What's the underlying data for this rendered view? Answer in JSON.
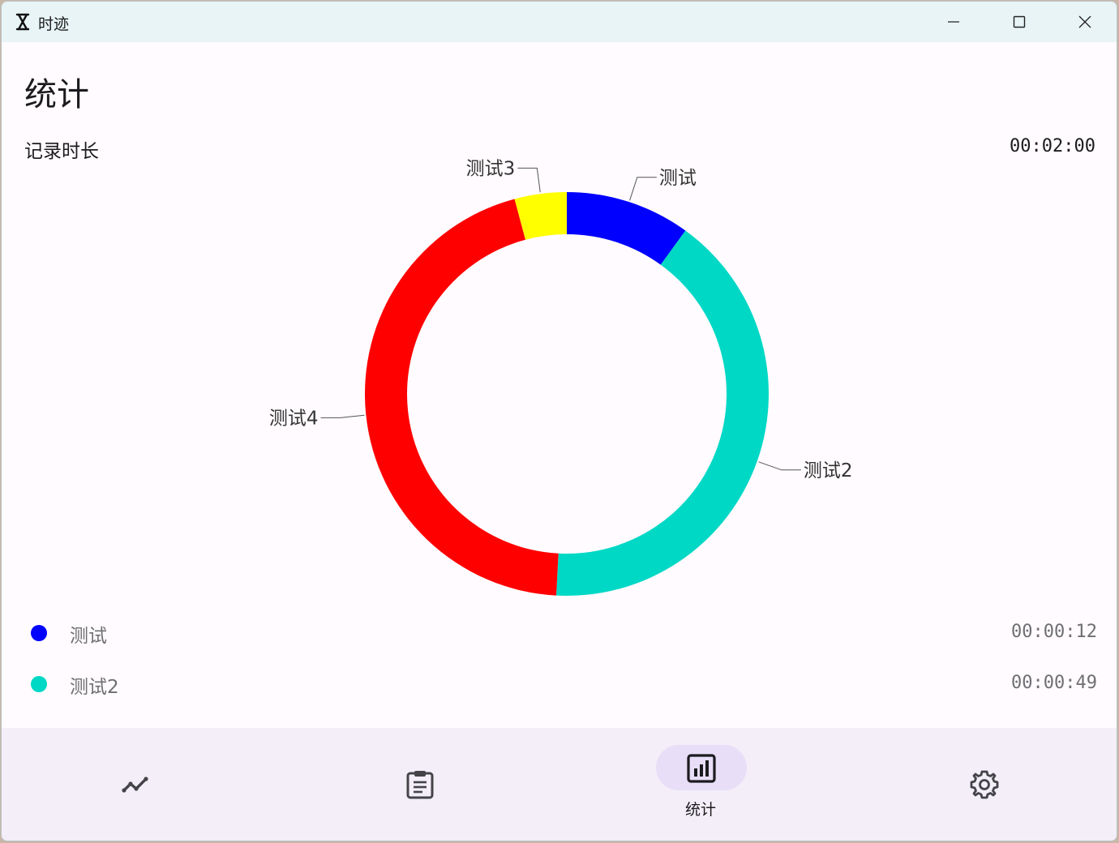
{
  "window": {
    "title": "时迹"
  },
  "page": {
    "title": "统计",
    "total_label": "记录时长",
    "total_value": "00:02:00"
  },
  "chart_data": {
    "type": "pie",
    "style": "donut",
    "categories": [
      "测试",
      "测试2",
      "测试4",
      "测试3"
    ],
    "values": [
      12,
      49,
      54,
      5
    ],
    "unit": "seconds",
    "colors": [
      "#0000ff",
      "#00d8c6",
      "#ff0000",
      "#ffff00"
    ],
    "labels_outside": true
  },
  "legend": [
    {
      "name": "测试",
      "duration": "00:00:12",
      "color": "#0000ff"
    },
    {
      "name": "测试2",
      "duration": "00:00:49",
      "color": "#00d8c6"
    }
  ],
  "nav": {
    "items": [
      {
        "icon": "trend-line-icon",
        "label": ""
      },
      {
        "icon": "clipboard-list-icon",
        "label": ""
      },
      {
        "icon": "bar-chart-icon",
        "label": "统计",
        "selected": true
      },
      {
        "icon": "gear-icon",
        "label": ""
      }
    ]
  },
  "colors": {
    "titlebar": "#e8f4f6",
    "background": "#fffbfe",
    "navbar": "#f3eef7",
    "nav_indicator": "#e8def8"
  }
}
